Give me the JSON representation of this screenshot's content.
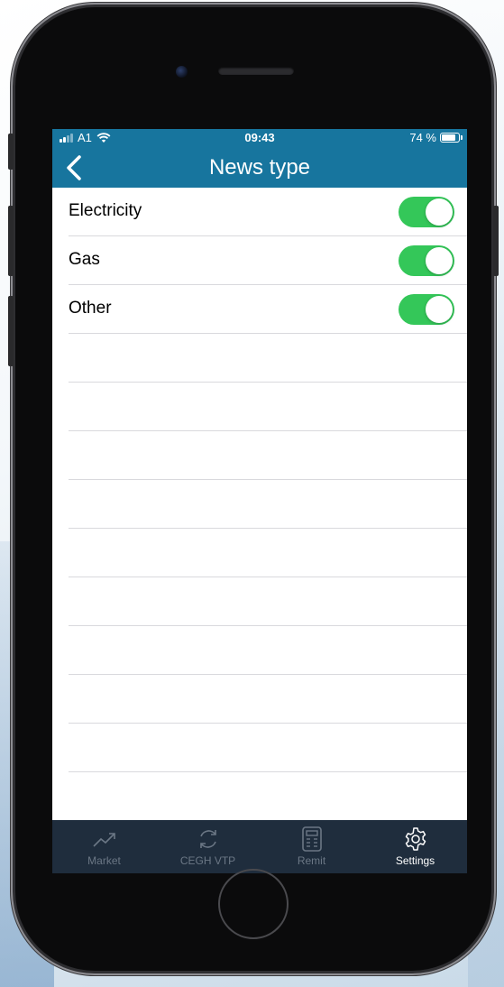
{
  "status_bar": {
    "carrier": "A1",
    "time": "09:43",
    "battery": "74 %",
    "battery_level": 0.74
  },
  "nav": {
    "title": "News type",
    "back_icon": "chevron-left-icon"
  },
  "news_types": [
    {
      "label": "Electricity",
      "enabled": true
    },
    {
      "label": "Gas",
      "enabled": true
    },
    {
      "label": "Other",
      "enabled": true
    }
  ],
  "tabbar": {
    "items": [
      {
        "label": "Market",
        "icon": "trend-up-icon",
        "active": false
      },
      {
        "label": "CEGH VTP",
        "icon": "refresh-icon",
        "active": false
      },
      {
        "label": "Remit",
        "icon": "calculator-icon",
        "active": false
      },
      {
        "label": "Settings",
        "icon": "gear-icon",
        "active": true
      }
    ]
  },
  "colors": {
    "header": "#17759e",
    "toggle_on": "#34c759",
    "tabbar": "#1f2d3d"
  }
}
